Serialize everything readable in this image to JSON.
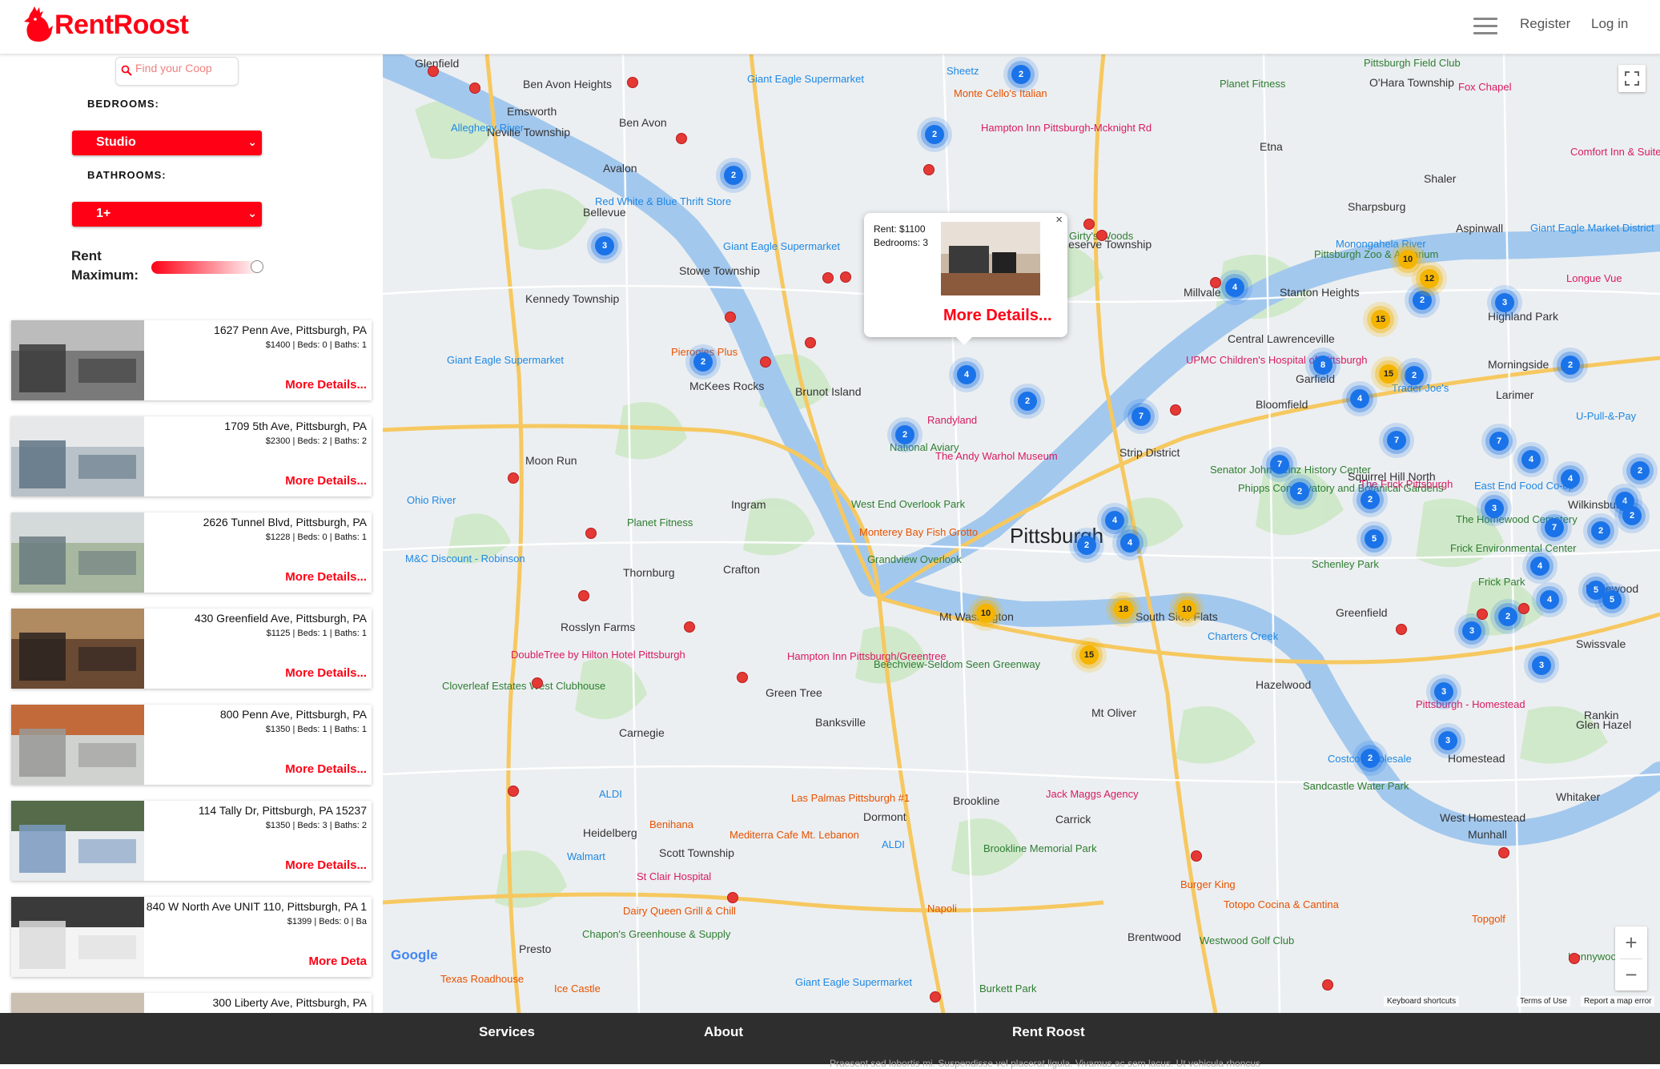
{
  "header": {
    "logo_text": "RentRoost",
    "nav": {
      "register": "Register",
      "login": "Log in"
    },
    "brand_color": "#ff0015"
  },
  "sidebar": {
    "search_placeholder": "Find your Coop",
    "bedrooms_label": "BEDROOMS:",
    "bedrooms_value": "Studio",
    "bathrooms_label": "BATHROOMS:",
    "bathrooms_value": "1+",
    "rent_label_1": "Rent",
    "rent_label_2": "Maximum:",
    "rent_max_fraction": 1.0
  },
  "listings": [
    {
      "address": "1627 Penn Ave, Pittsburgh, PA",
      "details": "$1400 | Beds: 0 | Baths: 1",
      "more": "More Details..."
    },
    {
      "address": "1709 5th Ave, Pittsburgh, PA",
      "details": "$2300 | Beds: 2 | Baths: 2",
      "more": "More Details..."
    },
    {
      "address": "2626 Tunnel Blvd, Pittsburgh, PA",
      "details": "$1228 | Beds: 0 | Baths: 1",
      "more": "More Details..."
    },
    {
      "address": "430 Greenfield Ave, Pittsburgh, PA",
      "details": "$1125 | Beds: 1 | Baths: 1",
      "more": "More Details..."
    },
    {
      "address": "800 Penn Ave, Pittsburgh, PA",
      "details": "$1350 | Beds: 1 | Baths: 1",
      "more": "More Details..."
    },
    {
      "address": "114 Tally Dr, Pittsburgh, PA 15237",
      "details": "$1350 | Beds: 3 | Baths: 2",
      "more": "More Details..."
    },
    {
      "address": "840 W North Ave UNIT 110, Pittsburgh, PA 1",
      "details": "$1399 | Beds: 0 | Ba",
      "more": "More Deta"
    },
    {
      "address": "300 Liberty Ave, Pittsburgh, PA",
      "details": "",
      "more": ""
    }
  ],
  "popup": {
    "rent_label": "Rent:",
    "rent_value": "$1100",
    "beds_label": "Bedrooms:",
    "beds_value": "3",
    "more": "More Details...",
    "close": "×"
  },
  "map": {
    "city_label": "Pittsburgh",
    "labels": [
      "Glenfield",
      "Ben Avon Heights",
      "Emsworth",
      "Ben Avon",
      "Neville Township",
      "Avalon",
      "Bellevue",
      "Stowe Township",
      "Kennedy Township",
      "McKees Rocks",
      "Brunot Island",
      "Moon Run",
      "Ingram",
      "Crafton",
      "Thornburg",
      "Rosslyn Farms",
      "Green Tree",
      "Carnegie",
      "Heidelberg",
      "Scott Township",
      "Presto",
      "Banksville",
      "Dormont",
      "Brookline",
      "Carrick",
      "Mt Oliver",
      "Brentwood",
      "Mt Washington",
      "South Side Flats",
      "Strip District",
      "Bloomfield",
      "Garfield",
      "Larimer",
      "Squirrel Hill North",
      "Sharpsburg",
      "Aspinwall",
      "Etna",
      "Millvale",
      "Central Lawrenceville",
      "Homestead",
      "West Homestead",
      "Munhall",
      "Whitaker",
      "Rankin",
      "Swissvale",
      "Edgewood",
      "Wilkinsburg",
      "O'Hara Township",
      "Reserve Township",
      "Shaler",
      "Greenfield",
      "Hazelwood",
      "Glen Hazel",
      "Highland Park",
      "Morningside",
      "Stanton Heights"
    ],
    "poi_labels": [
      "Giant Eagle Supermarket",
      "Sheetz",
      "Monte Cello's Italian",
      "Hampton Inn Pittsburgh-Mcknight Rd",
      "Planet Fitness",
      "Pittsburgh Field Club",
      "Fox Chapel",
      "Comfort Inn & Suites",
      "Red White & Blue Thrift Store",
      "Giant Eagle Supermarket",
      "Girty's Woods",
      "Pittsburgh Zoo & Aquarium",
      "Giant Eagle Market District",
      "Longue Vue",
      "Pierogies Plus",
      "Giant Eagle Supermarket",
      "UPMC Children's Hospital of Pittsburgh",
      "Trader Joe's",
      "U-Pull-&-Pay",
      "Randyland",
      "National Aviary",
      "The Andy Warhol Museum",
      "Senator John Heinz History Center",
      "Phipps Conservatory and Botanical Gardens",
      "The Frick Pittsburgh",
      "East End Food Co-op",
      "West End Overlook Park",
      "Planet Fitness",
      "Monterey Bay Fish Grotto",
      "Grandview Overlook",
      "M&C Discount - Robinson",
      "Schenley Park",
      "The Homewood Cemetery",
      "Frick Environmental Center",
      "Frick Park",
      "DoubleTree by Hilton Hotel Pittsburgh",
      "Hampton Inn Pittsburgh/Greentree",
      "Beechview-Seldom Seen Greenway",
      "Cloverleaf Estates West Clubhouse",
      "Jack Maggs Agency",
      "Pittsburgh - Homestead",
      "Costco Wholesale",
      "Sandcastle Water Park",
      "ALDI",
      "Las Palmas Pittsburgh #1",
      "Walmart",
      "Benihana",
      "Mediterra Cafe Mt. Lebanon",
      "Brookline Memorial Park",
      "ALDI",
      "Burger King",
      "Totopo Cocina & Cantina",
      "St Clair Hospital",
      "Dairy Queen Grill & Chill",
      "Napoli",
      "Chapon's Greenhouse & Supply",
      "Westwood Golf Club",
      "Kennywood",
      "Topgolf",
      "Texas Roadhouse",
      "Ice Castle",
      "Giant Eagle Supermarket",
      "Burkett Park",
      "Ohio River",
      "Allegheny River",
      "Monongahela River",
      "Charters Creek"
    ],
    "clusters": [
      {
        "n": "2",
        "c": "blue"
      },
      {
        "n": "2",
        "c": "blue"
      },
      {
        "n": "2",
        "c": "blue"
      },
      {
        "n": "3",
        "c": "blue"
      },
      {
        "n": "2",
        "c": "blue"
      },
      {
        "n": "2",
        "c": "blue"
      },
      {
        "n": "4",
        "c": "blue"
      },
      {
        "n": "2",
        "c": "blue"
      },
      {
        "n": "7",
        "c": "blue"
      },
      {
        "n": "2",
        "c": "blue"
      },
      {
        "n": "7",
        "c": "blue"
      },
      {
        "n": "2",
        "c": "blue"
      },
      {
        "n": "5",
        "c": "blue"
      },
      {
        "n": "2",
        "c": "blue"
      },
      {
        "n": "4",
        "c": "blue"
      },
      {
        "n": "4",
        "c": "blue"
      },
      {
        "n": "2",
        "c": "blue"
      },
      {
        "n": "3",
        "c": "blue"
      },
      {
        "n": "4",
        "c": "blue"
      },
      {
        "n": "8",
        "c": "blue"
      },
      {
        "n": "4",
        "c": "blue"
      },
      {
        "n": "2",
        "c": "blue"
      },
      {
        "n": "2",
        "c": "blue"
      },
      {
        "n": "7",
        "c": "blue"
      },
      {
        "n": "7",
        "c": "blue"
      },
      {
        "n": "2",
        "c": "blue"
      },
      {
        "n": "4",
        "c": "blue"
      },
      {
        "n": "2",
        "c": "blue"
      },
      {
        "n": "4",
        "c": "blue"
      },
      {
        "n": "4",
        "c": "blue"
      },
      {
        "n": "3",
        "c": "blue"
      },
      {
        "n": "7",
        "c": "blue"
      },
      {
        "n": "4",
        "c": "blue"
      },
      {
        "n": "2",
        "c": "blue"
      },
      {
        "n": "5",
        "c": "blue"
      },
      {
        "n": "2",
        "c": "blue"
      },
      {
        "n": "5",
        "c": "blue"
      },
      {
        "n": "4",
        "c": "blue"
      },
      {
        "n": "2",
        "c": "blue"
      },
      {
        "n": "3",
        "c": "blue"
      },
      {
        "n": "3",
        "c": "blue"
      },
      {
        "n": "3",
        "c": "blue"
      },
      {
        "n": "3",
        "c": "blue"
      },
      {
        "n": "2",
        "c": "blue"
      },
      {
        "n": "10",
        "c": "yellow"
      },
      {
        "n": "12",
        "c": "yellow"
      },
      {
        "n": "15",
        "c": "yellow"
      },
      {
        "n": "15",
        "c": "yellow"
      },
      {
        "n": "10",
        "c": "yellow"
      },
      {
        "n": "18",
        "c": "yellow"
      },
      {
        "n": "10",
        "c": "yellow"
      },
      {
        "n": "15",
        "c": "yellow"
      }
    ],
    "attribution": {
      "google": "Google",
      "shortcuts": "Keyboard shortcuts",
      "terms": "Terms of Use",
      "report": "Report a map error"
    },
    "zoom_in": "+",
    "zoom_out": "−"
  },
  "footer": {
    "services": "Services",
    "about": "About",
    "brand": "Rent Roost",
    "text": "Praesent sed lobortis mi. Suspendisse vel placerat ligula. Vivamus ac sem lacus. Ut vehicula rhoncus"
  }
}
